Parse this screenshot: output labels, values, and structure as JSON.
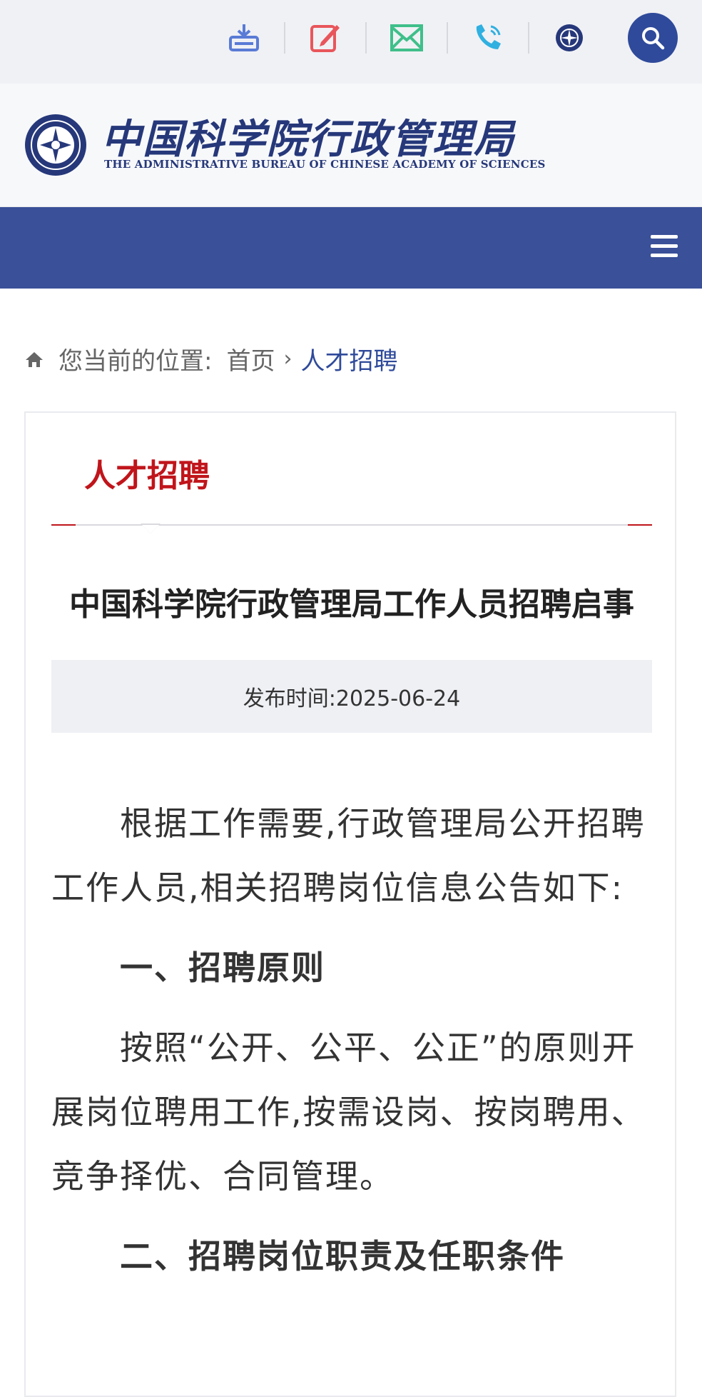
{
  "topbar": {
    "icons": [
      "download-icon",
      "edit-icon",
      "mail-icon",
      "phone-icon",
      "emblem-icon"
    ],
    "search_icon": "search-icon"
  },
  "logo": {
    "name_cn": "中国科学院行政管理局",
    "name_en": "THE ADMINISTRATIVE BUREAU OF CHINESE ACADEMY OF SCIENCES"
  },
  "nav": {
    "menu_icon": "hamburger-menu-icon"
  },
  "breadcrumb": {
    "label": "您当前的位置:",
    "home": "首页",
    "separator": "›",
    "current": "人才招聘"
  },
  "section": {
    "title": "人才招聘"
  },
  "article": {
    "title": "中国科学院行政管理局工作人员招聘启事",
    "date": "发布时间:2025-06-24",
    "para1": "根据工作需要,行政管理局公开招聘工作人员,相关招聘岗位信息公告如下:",
    "heading1": "一、招聘原则",
    "para2": "按照“公开、公平、公正”的原则开展岗位聘用工作,按需设岗、按岗聘用、竞争择优、合同管理。",
    "heading2": "二、招聘岗位职责及任职条件"
  },
  "colors": {
    "brand_blue": "#3a5098",
    "accent_red": "#c0151b"
  }
}
